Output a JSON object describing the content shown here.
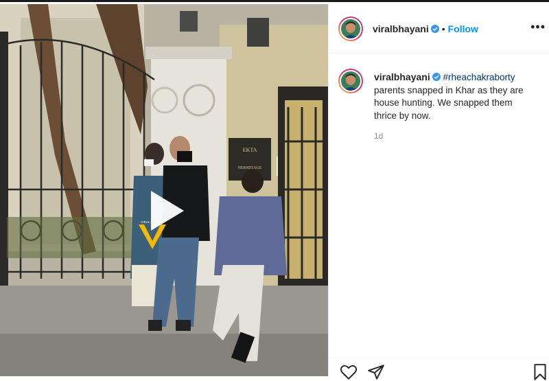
{
  "post": {
    "username": "viralbhayani",
    "follow_label": "Follow",
    "separator": "•",
    "more_label": "•••",
    "caption": {
      "username": "viralbhayani",
      "hashtag": "#rheachakraborty",
      "text": " parents snapped in Khar as they are house hunting. We snapped them thrice by now."
    },
    "timestamp": "1d"
  },
  "video": {
    "watermark_text": "VIRAL BHAYANI",
    "sign_text": "EKTA",
    "sign_text_2": "HERMITAGE"
  },
  "colors": {
    "accent": "#0095f6",
    "hashtag": "#00376b",
    "muted": "#8e8e8e",
    "watermark": "#f5b800"
  },
  "icons": [
    "verified-badge-icon",
    "more-options-icon",
    "play-icon",
    "heart-icon",
    "share-icon",
    "bookmark-icon"
  ]
}
